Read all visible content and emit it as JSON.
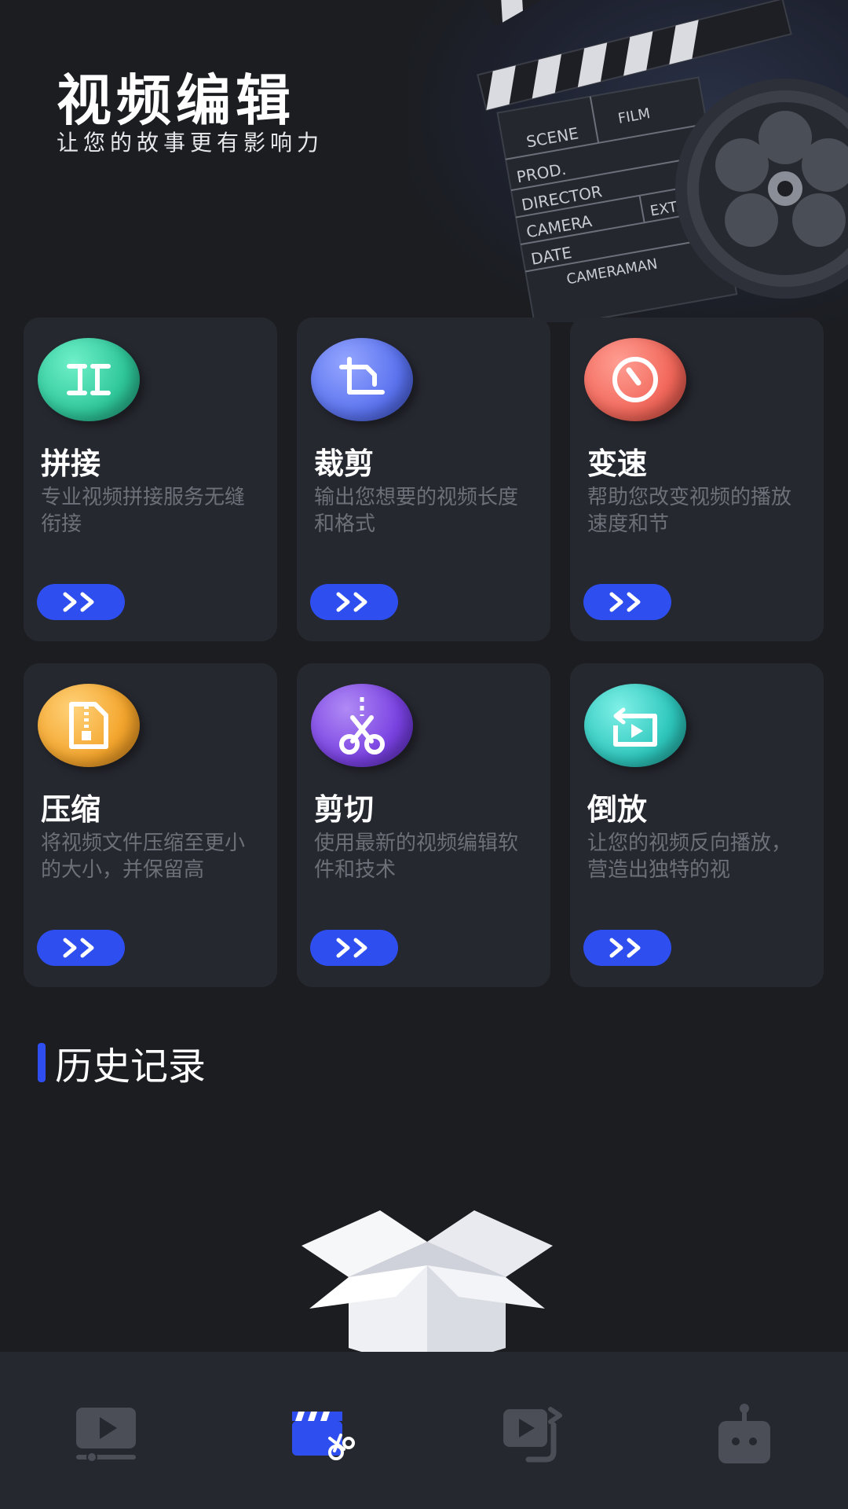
{
  "header": {
    "title": "视频编辑",
    "subtitle": "让您的故事更有影响力",
    "art": {
      "scene": "SCENE",
      "film": "FILM",
      "prod": "PROD.",
      "director": "DIRECTOR",
      "camera": "CAMERA",
      "ext": "EXT.",
      "date": "DATE",
      "cameraman": "CAMERAMAN"
    }
  },
  "tools": [
    {
      "name": "拼接",
      "desc": "专业视频拼接服务无缝衔接",
      "icon": "merge-icon",
      "color": "#2fc79a"
    },
    {
      "name": "裁剪",
      "desc": "输出您想要的视频长度和格式",
      "icon": "crop-icon",
      "color": "#5b73ef"
    },
    {
      "name": "变速",
      "desc": "帮助您改变视频的播放速度和节",
      "icon": "speed-icon",
      "color": "#f2675a"
    },
    {
      "name": "压缩",
      "desc": "将视频文件压缩至更小的大小，并保留高",
      "icon": "compress-icon",
      "color": "#f4a52c"
    },
    {
      "name": "剪切",
      "desc": "使用最新的视频编辑软件和技术",
      "icon": "scissors-icon",
      "color": "#7a42e2"
    },
    {
      "name": "倒放",
      "desc": "让您的视频反向播放，营造出独特的视",
      "icon": "reverse-icon",
      "color": "#2ec7bd"
    }
  ],
  "history": {
    "title": "历史记录"
  },
  "nav": [
    {
      "icon": "video-player-icon",
      "active": false
    },
    {
      "icon": "clapper-scissors-icon",
      "active": true
    },
    {
      "icon": "video-convert-icon",
      "active": false
    },
    {
      "icon": "robot-icon",
      "active": false
    }
  ],
  "colors": {
    "accent": "#2f4ef0",
    "card": "#262830",
    "background": "#1b1d21"
  }
}
